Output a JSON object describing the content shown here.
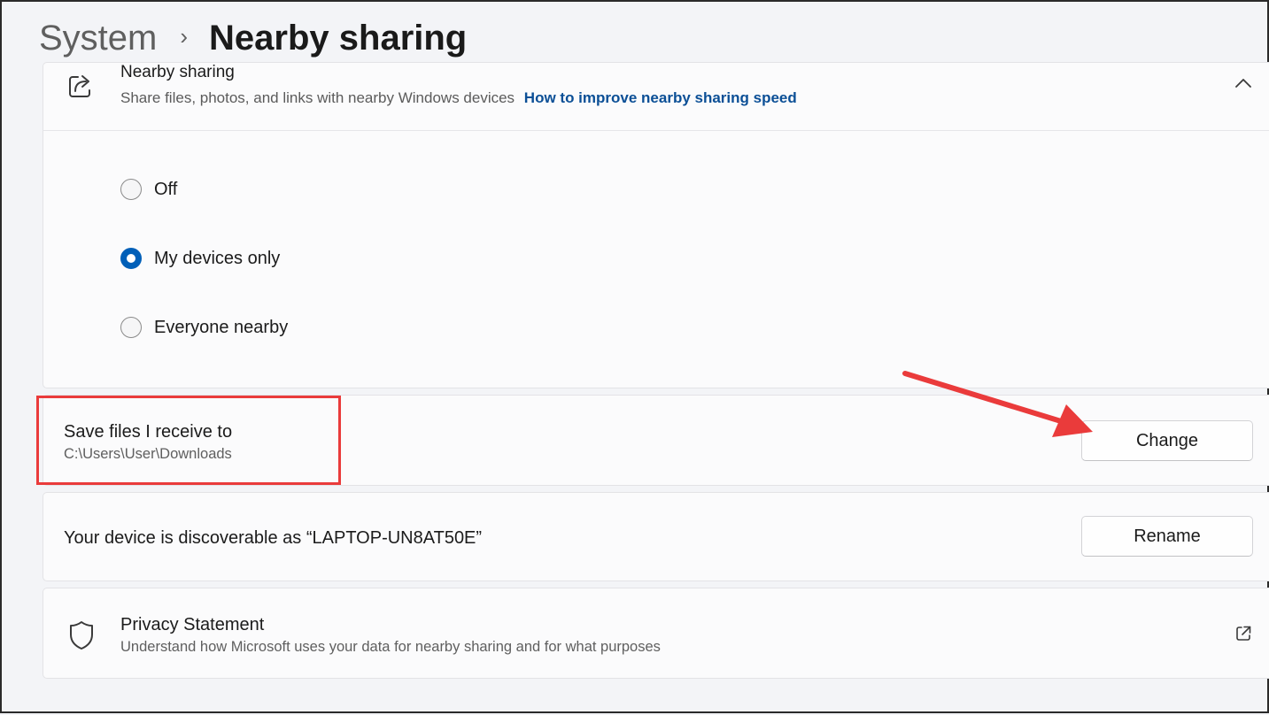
{
  "breadcrumb": {
    "parent": "System",
    "separator": "›",
    "current": "Nearby sharing"
  },
  "main_card": {
    "title": "Nearby sharing",
    "description": "Share files, photos, and links with nearby Windows devices",
    "link": "How to improve nearby sharing speed",
    "icon": "share-icon",
    "expand_icon": "chevron-up-icon"
  },
  "options": [
    {
      "label": "Off",
      "selected": false
    },
    {
      "label": "My devices only",
      "selected": true
    },
    {
      "label": "Everyone nearby",
      "selected": false
    }
  ],
  "save_location": {
    "title": "Save files I receive to",
    "path": "C:\\Users\\User\\Downloads",
    "button": "Change"
  },
  "device": {
    "text": "Your device is discoverable as “LAPTOP-UN8AT50E”",
    "button": "Rename"
  },
  "privacy": {
    "title": "Privacy Statement",
    "description": "Understand how Microsoft uses your data for nearby sharing and for what purposes",
    "icon": "shield-icon",
    "link_icon": "external-link-icon"
  },
  "colors": {
    "accent": "#005fb8",
    "link": "#0b4f96",
    "annotation": "#ea3b3b"
  }
}
